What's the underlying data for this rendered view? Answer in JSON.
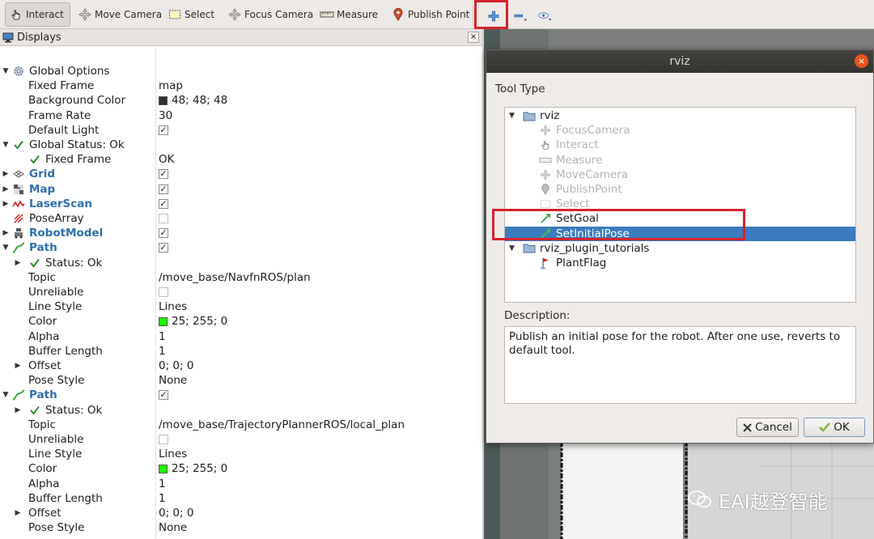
{
  "toolbar": {
    "interact": "Interact",
    "move_camera": "Move Camera",
    "select": "Select",
    "focus_camera": "Focus Camera",
    "measure": "Measure",
    "publish_point": "Publish Point",
    "add_tool_icon": "plus-icon",
    "remove_tool_icon": "minus-icon",
    "view_icon": "eye-icon"
  },
  "displays": {
    "title": "Displays",
    "close": "×",
    "rows": [
      {
        "label": "Global Options",
        "value": ""
      },
      {
        "label": "Fixed Frame",
        "value": "map"
      },
      {
        "label": "Background Color",
        "value": "48; 48; 48"
      },
      {
        "label": "Frame Rate",
        "value": "30"
      },
      {
        "label": "Default Light",
        "value": ""
      },
      {
        "label": "Global Status: Ok",
        "value": ""
      },
      {
        "label": "Fixed Frame",
        "value": "OK"
      },
      {
        "label": "Grid",
        "value": ""
      },
      {
        "label": "Map",
        "value": ""
      },
      {
        "label": "LaserScan",
        "value": ""
      },
      {
        "label": "PoseArray",
        "value": ""
      },
      {
        "label": "RobotModel",
        "value": ""
      },
      {
        "label": "Path",
        "value": ""
      },
      {
        "label": "Status: Ok",
        "value": ""
      },
      {
        "label": "Topic",
        "value": "/move_base/NavfnROS/plan"
      },
      {
        "label": "Unreliable",
        "value": ""
      },
      {
        "label": "Line Style",
        "value": "Lines"
      },
      {
        "label": "Color",
        "value": "25; 255; 0"
      },
      {
        "label": "Alpha",
        "value": "1"
      },
      {
        "label": "Buffer Length",
        "value": "1"
      },
      {
        "label": "Offset",
        "value": "0; 0; 0"
      },
      {
        "label": "Pose Style",
        "value": "None"
      },
      {
        "label": "Path",
        "value": ""
      },
      {
        "label": "Status: Ok",
        "value": ""
      },
      {
        "label": "Topic",
        "value": "/move_base/TrajectoryPlannerROS/local_plan"
      },
      {
        "label": "Unreliable",
        "value": ""
      },
      {
        "label": "Line Style",
        "value": "Lines"
      },
      {
        "label": "Color",
        "value": "25; 255; 0"
      },
      {
        "label": "Alpha",
        "value": "1"
      },
      {
        "label": "Buffer Length",
        "value": "1"
      },
      {
        "label": "Offset",
        "value": "0; 0; 0"
      },
      {
        "label": "Pose Style",
        "value": "None"
      }
    ],
    "colors": {
      "background_swatch": "#303030",
      "path_swatch": "#19ff00"
    }
  },
  "dialog": {
    "title": "rviz",
    "close": "×",
    "tool_type_label": "Tool Type",
    "tree": [
      {
        "label": "rviz"
      },
      {
        "label": "FocusCamera"
      },
      {
        "label": "Interact"
      },
      {
        "label": "Measure"
      },
      {
        "label": "MoveCamera"
      },
      {
        "label": "PublishPoint"
      },
      {
        "label": "Select"
      },
      {
        "label": "SetGoal"
      },
      {
        "label": "SetInitialPose"
      },
      {
        "label": "rviz_plugin_tutorials"
      },
      {
        "label": "PlantFlag"
      }
    ],
    "description_label": "Description:",
    "description": "Publish an initial pose for the robot. After one use, reverts to default tool.",
    "cancel": "Cancel",
    "ok": "OK"
  },
  "watermark": "EAI越登智能"
}
